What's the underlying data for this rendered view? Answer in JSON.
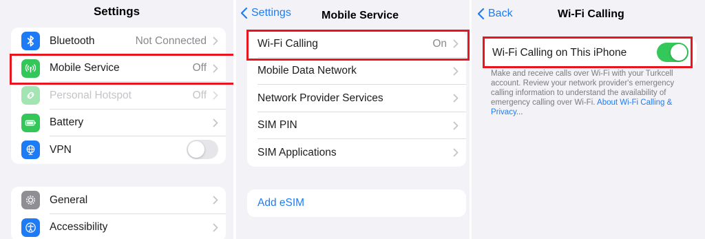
{
  "panel1": {
    "title": "Settings",
    "group1": [
      {
        "label": "Bluetooth",
        "value": "Not Connected",
        "icon": "bluetooth-icon",
        "color": "#1d7bf5"
      },
      {
        "label": "Mobile Service",
        "value": "Off",
        "icon": "antenna-icon",
        "color": "#33c659"
      },
      {
        "label": "Personal Hotspot",
        "value": "Off",
        "icon": "hotspot-icon",
        "color": "#33c659"
      },
      {
        "label": "Battery",
        "value": "",
        "icon": "battery-icon",
        "color": "#33c659"
      },
      {
        "label": "VPN",
        "value": "",
        "icon": "globe-icon",
        "color": "#1d7bf5",
        "toggle": "off"
      }
    ],
    "group2": [
      {
        "label": "General",
        "icon": "gear-icon",
        "color": "#8e8e93"
      },
      {
        "label": "Accessibility",
        "icon": "accessibility-icon",
        "color": "#1d7bf5"
      }
    ]
  },
  "panel2": {
    "back": "Settings",
    "title": "Mobile Service",
    "rows": [
      {
        "label": "Wi-Fi Calling",
        "value": "On"
      },
      {
        "label": "Mobile Data Network",
        "value": ""
      },
      {
        "label": "Network Provider Services",
        "value": ""
      },
      {
        "label": "SIM PIN",
        "value": ""
      },
      {
        "label": "SIM Applications",
        "value": ""
      }
    ],
    "add_esim": "Add eSIM"
  },
  "panel3": {
    "back": "Back",
    "title": "Wi-Fi Calling",
    "toggle_label": "Wi-Fi Calling on This iPhone",
    "toggle_state": "on",
    "footer_text": "Make and receive calls over Wi-Fi with your Turkcell account. Review your network provider's emergency calling information to understand the availability of emergency calling over Wi-Fi.",
    "footer_link": "About Wi-Fi Calling & Privacy..."
  },
  "highlight_color": "#e8141e",
  "accent_color": "#1e7cf2"
}
